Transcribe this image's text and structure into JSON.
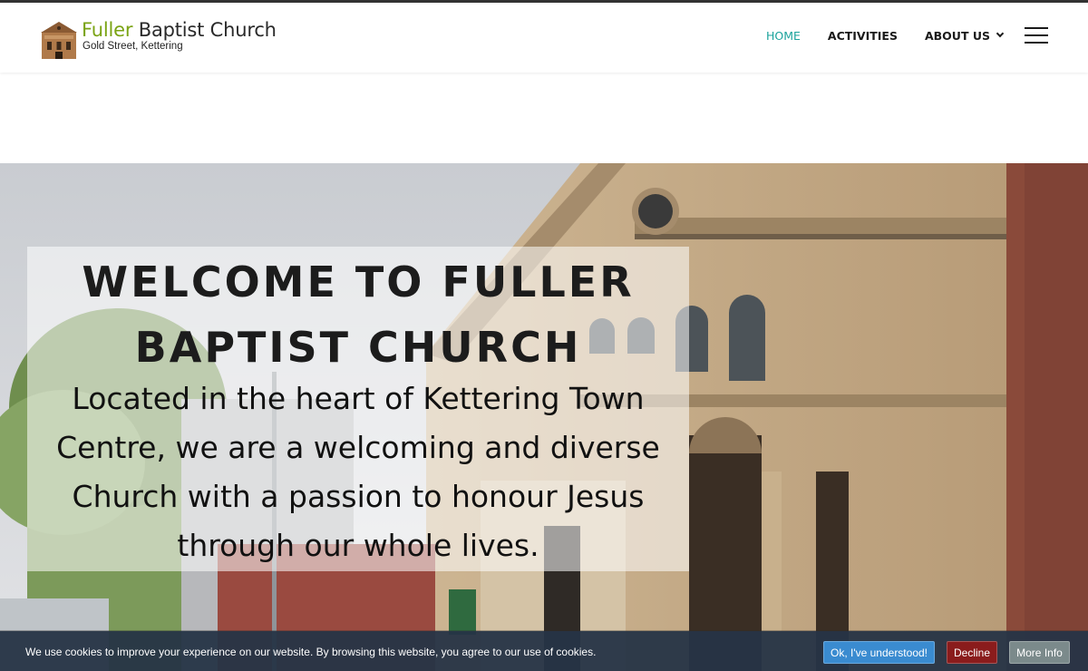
{
  "header": {
    "logo": {
      "title_accent": "Fuller",
      "title_rest": " Baptist Church",
      "subtitle": "Gold Street, Kettering"
    },
    "nav": [
      {
        "label": "HOME",
        "active": true
      },
      {
        "label": "ACTIVITIES",
        "active": false
      },
      {
        "label": "ABOUT US",
        "active": false,
        "has_dropdown": true
      }
    ],
    "menu_icon": "hamburger-icon"
  },
  "hero": {
    "title": "WELCOME TO FULLER BAPTIST CHURCH",
    "text": "Located in the heart of Kettering Town Centre, we are a welcoming and diverse Church with a passion to honour Jesus through our whole lives."
  },
  "cookie_bar": {
    "message": "We use cookies to improve your experience on our website. By browsing this website, you agree to our use of cookies.",
    "ok_label": "Ok, I've understood!",
    "decline_label": "Decline",
    "more_label": "More Info"
  },
  "colors": {
    "accent_green": "#7aa313",
    "nav_active": "#1ba39c",
    "cookie_ok": "#3a8bd0",
    "cookie_decline": "#8a1c1c",
    "cookie_more": "#7b8a8b"
  }
}
